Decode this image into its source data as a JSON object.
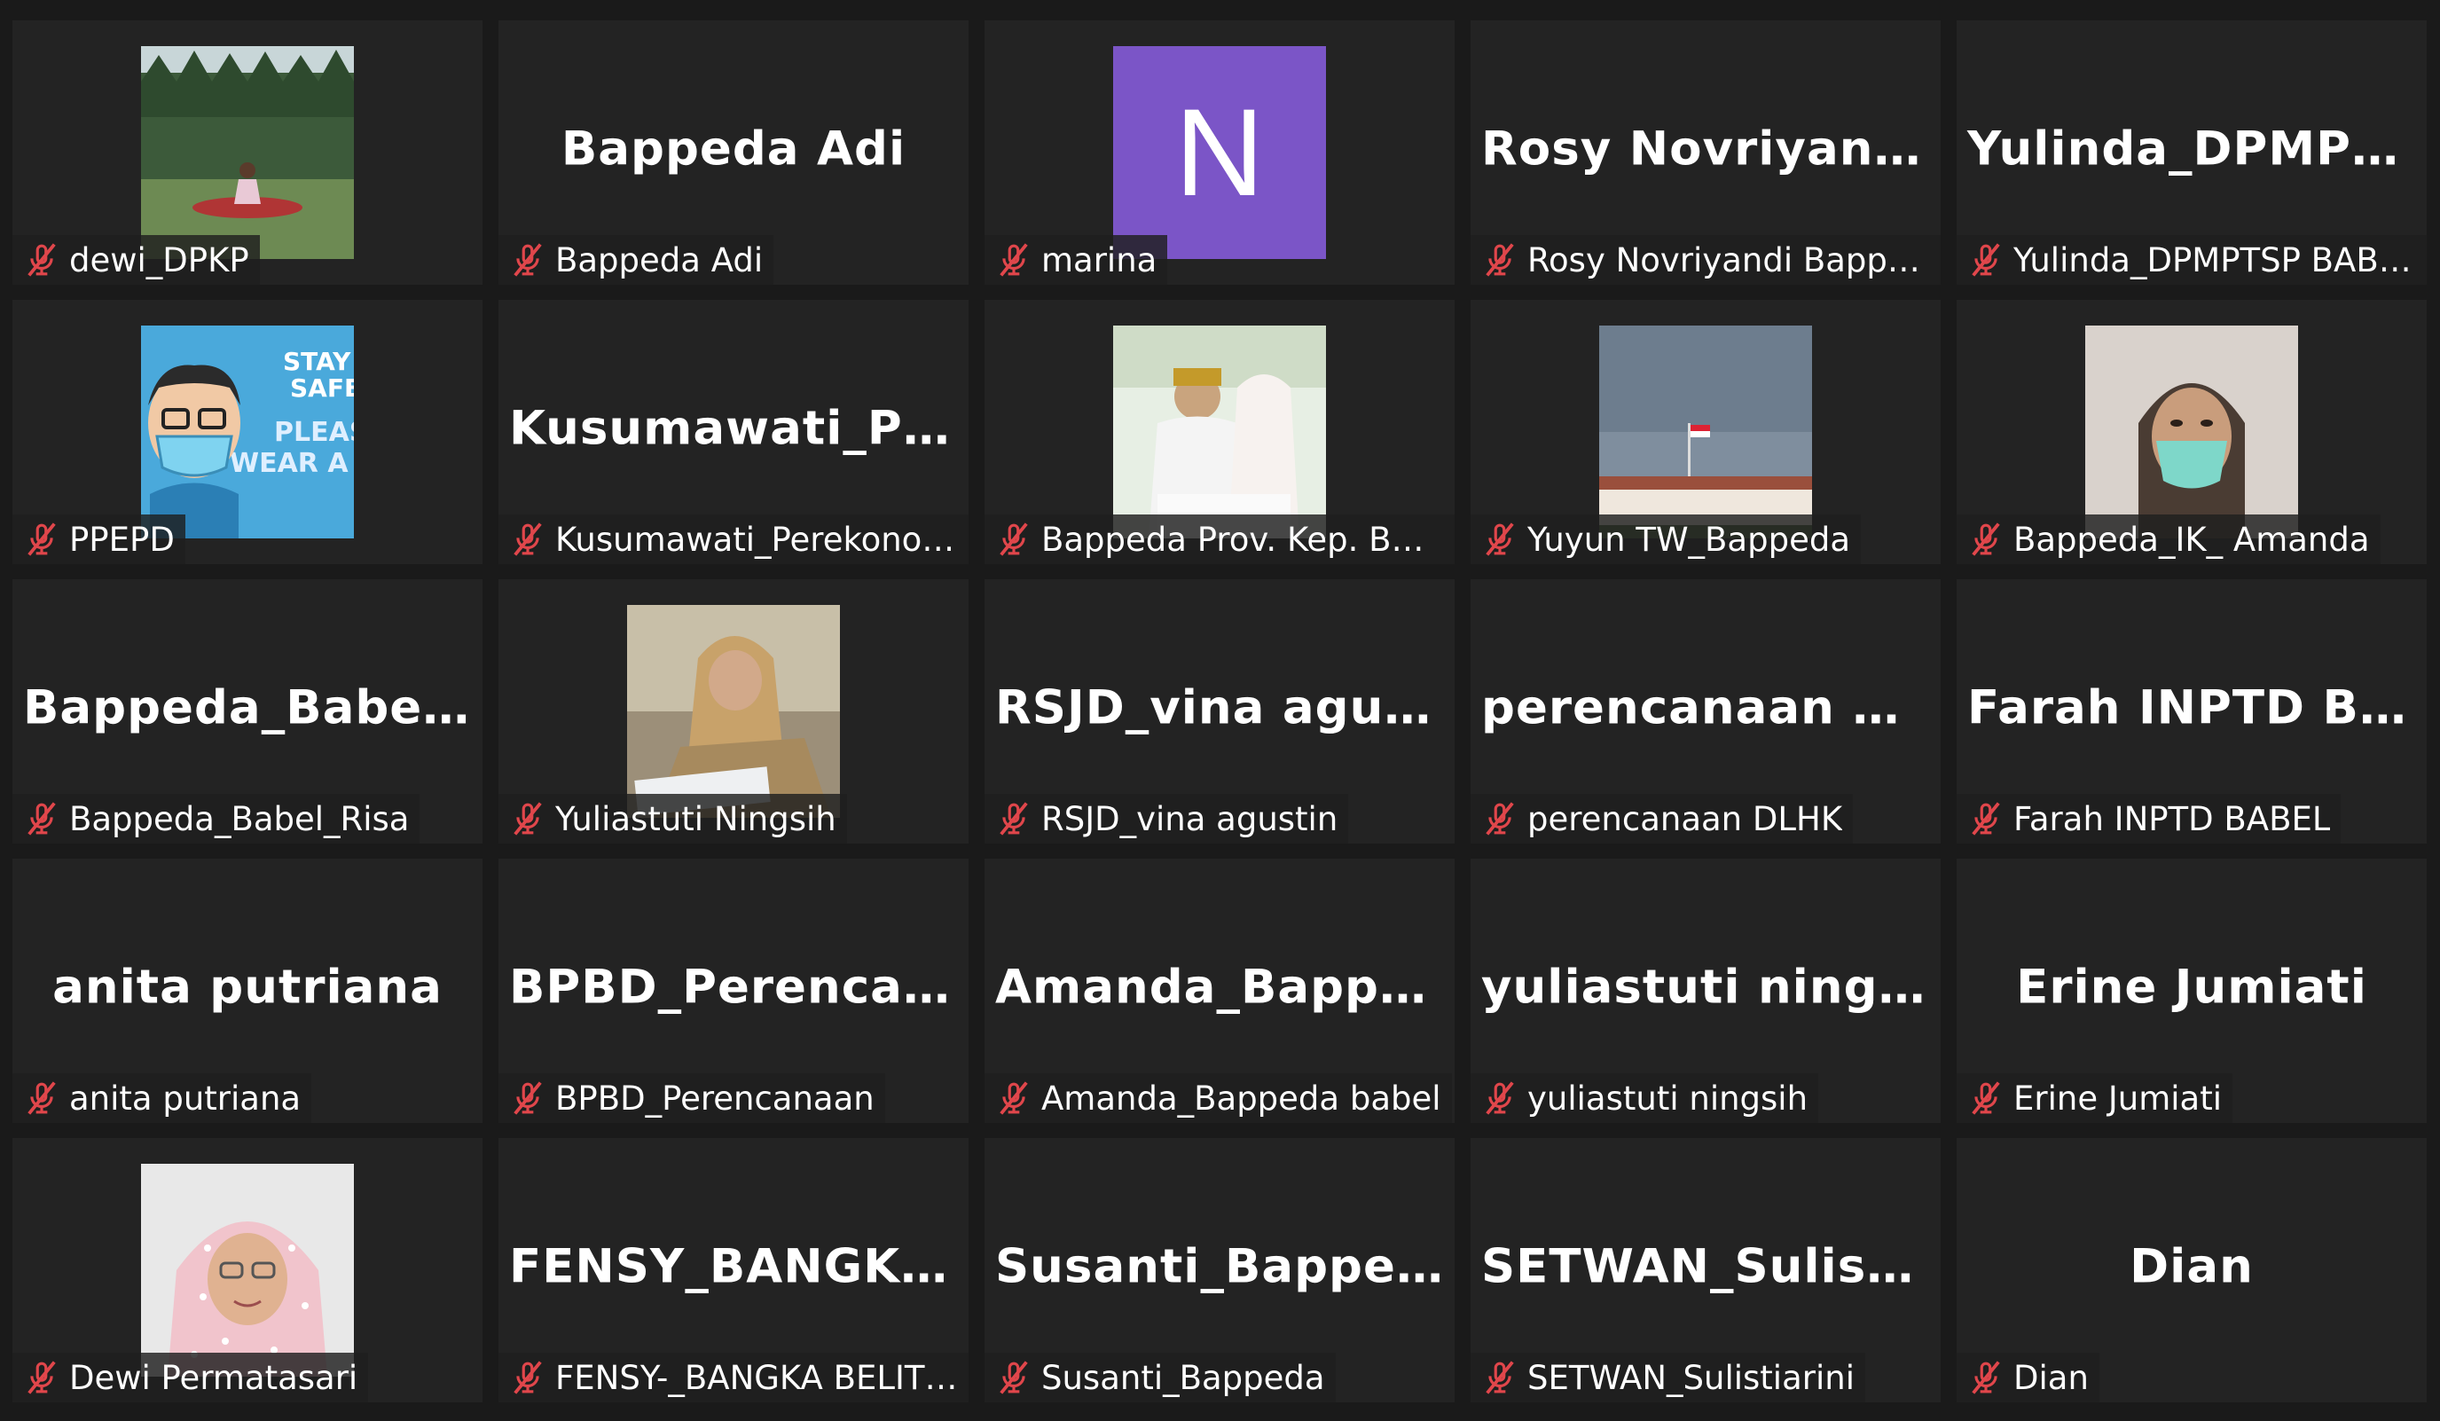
{
  "accent": {
    "muted_mic": "#e0464b",
    "avatar_bg": "#7b55c7"
  },
  "participants": [
    {
      "name": "dewi_DPKP",
      "display": "",
      "media": "photo-forest-meditation"
    },
    {
      "name": "Bappeda Adi",
      "display": "Bappeda Adi",
      "media": "none"
    },
    {
      "name": "marina",
      "display": "N",
      "media": "letter-avatar"
    },
    {
      "name": "Rosy Novriyandi Bappeda...",
      "display": "Rosy  Novriyandi...",
      "media": "none"
    },
    {
      "name": "Yulinda_DPMPTSP BABEL",
      "display": "Yulinda_DPMPT...",
      "media": "none"
    },
    {
      "name": "PPEPD",
      "display": "",
      "media": "photo-stay-safe-cartoon"
    },
    {
      "name": "Kusumawati_Perekonomi...",
      "display": "Kusumawati_Per...",
      "media": "none"
    },
    {
      "name": "Bappeda Prov. Kep. Babel...",
      "display": "",
      "media": "photo-wedding"
    },
    {
      "name": "Yuyun TW_Bappeda",
      "display": "",
      "media": "photo-building-sky"
    },
    {
      "name": "Bappeda_IK_ Amanda",
      "display": "",
      "media": "photo-woman-mask"
    },
    {
      "name": "Bappeda_Babel_Risa",
      "display": "Bappeda_Babel_...",
      "media": "none"
    },
    {
      "name": "Yuliastuti Ningsih",
      "display": "",
      "media": "photo-office-worker"
    },
    {
      "name": "RSJD_vina agustin",
      "display": "RSJD_vina agustin",
      "media": "none"
    },
    {
      "name": "perencanaan DLHK",
      "display": "perencanaan  DL...",
      "media": "none"
    },
    {
      "name": "Farah INPTD BABEL",
      "display": "Farah  INPTD  BA...",
      "media": "none"
    },
    {
      "name": "anita putriana",
      "display": "anita putriana",
      "media": "none"
    },
    {
      "name": "BPBD_Perencanaan",
      "display": "BPBD_Perencan...",
      "media": "none"
    },
    {
      "name": "Amanda_Bappeda babel",
      "display": "Amanda_Bappe...",
      "media": "none"
    },
    {
      "name": "yuliastuti ningsih",
      "display": "yuliastuti ningsih",
      "media": "none"
    },
    {
      "name": "Erine Jumiati",
      "display": "Erine Jumiati",
      "media": "none"
    },
    {
      "name": "Dewi Permatasari",
      "display": "",
      "media": "photo-hijab-portrait"
    },
    {
      "name": "FENSY-_BANGKA BELITU...",
      "display": "FENSY_BANGKA...",
      "media": "none"
    },
    {
      "name": "Susanti_Bappeda",
      "display": "Susanti_Bappeda",
      "media": "none"
    },
    {
      "name": "SETWAN_Sulistiarini",
      "display": "SETWAN_Sulisti...",
      "media": "none"
    },
    {
      "name": "Dian",
      "display": "Dian",
      "media": "none"
    }
  ]
}
